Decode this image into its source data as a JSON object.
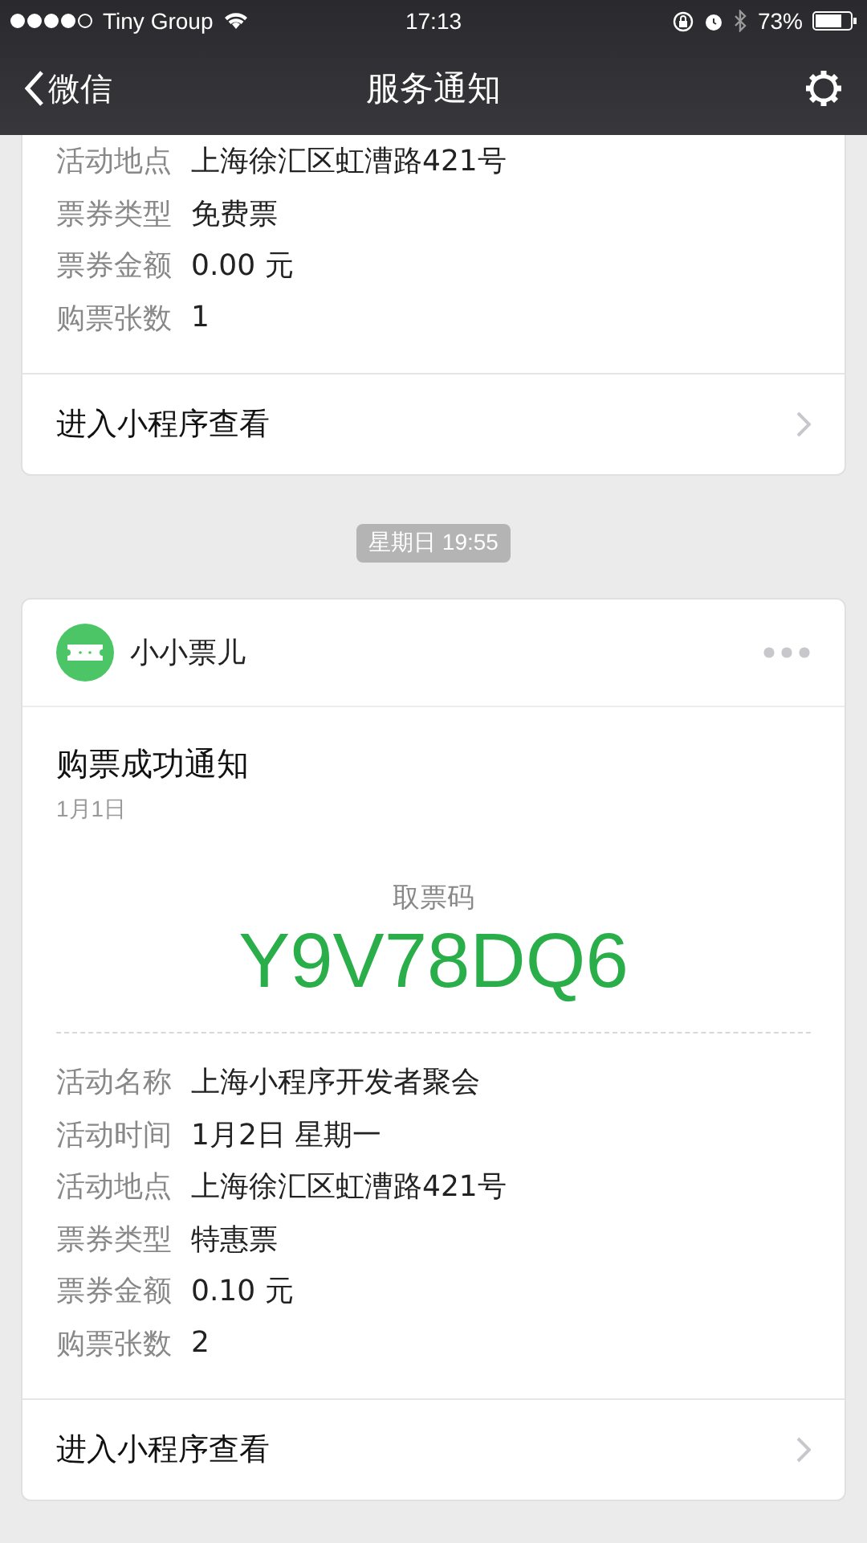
{
  "status_bar": {
    "carrier": "Tiny Group",
    "time": "17:13",
    "battery": "73%"
  },
  "nav": {
    "back": "微信",
    "title": "服务通知"
  },
  "earlier_card": {
    "rows": [
      {
        "label": "活动地点",
        "value": "上海徐汇区虹漕路421号"
      },
      {
        "label": "票券类型",
        "value": "免费票"
      },
      {
        "label": "票券金额",
        "value": "0.00 元"
      },
      {
        "label": "购票张数",
        "value": "1"
      }
    ],
    "link": "进入小程序查看"
  },
  "timestamp": "星期日 19:55",
  "card": {
    "app_name": "小小票儿",
    "title": "购票成功通知",
    "date": "1月1日",
    "code_label": "取票码",
    "code": "Y9V78DQ6",
    "rows": [
      {
        "label": "活动名称",
        "value": "上海小程序开发者聚会"
      },
      {
        "label": "活动时间",
        "value": "1月2日 星期一"
      },
      {
        "label": "活动地点",
        "value": "上海徐汇区虹漕路421号"
      },
      {
        "label": "票券类型",
        "value": "特惠票"
      },
      {
        "label": "票券金额",
        "value": "0.10 元"
      },
      {
        "label": "购票张数",
        "value": "2"
      }
    ],
    "link": "进入小程序查看"
  }
}
